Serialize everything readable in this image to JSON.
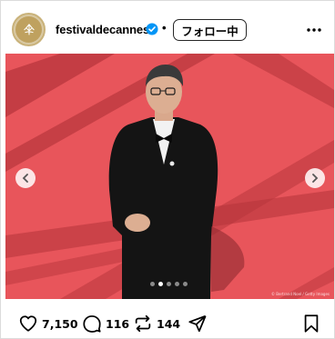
{
  "post": {
    "username": "festivaldecannes",
    "verified": true,
    "separator": "•",
    "follow_label": "フォロー中",
    "more_icon": "more-horizontal-icon"
  },
  "media": {
    "carousel_count": 5,
    "carousel_active_index": 1,
    "photo_credit": "© Bertrand Noel / Getty Images",
    "background_color": "#e8555b"
  },
  "actions": {
    "likes": "7,150",
    "comments": "116",
    "reposts": "144"
  },
  "colors": {
    "text": "#000000",
    "border": "#dbdbdb",
    "verified_blue": "#0095f6",
    "carpet_red": "#e8555b"
  }
}
